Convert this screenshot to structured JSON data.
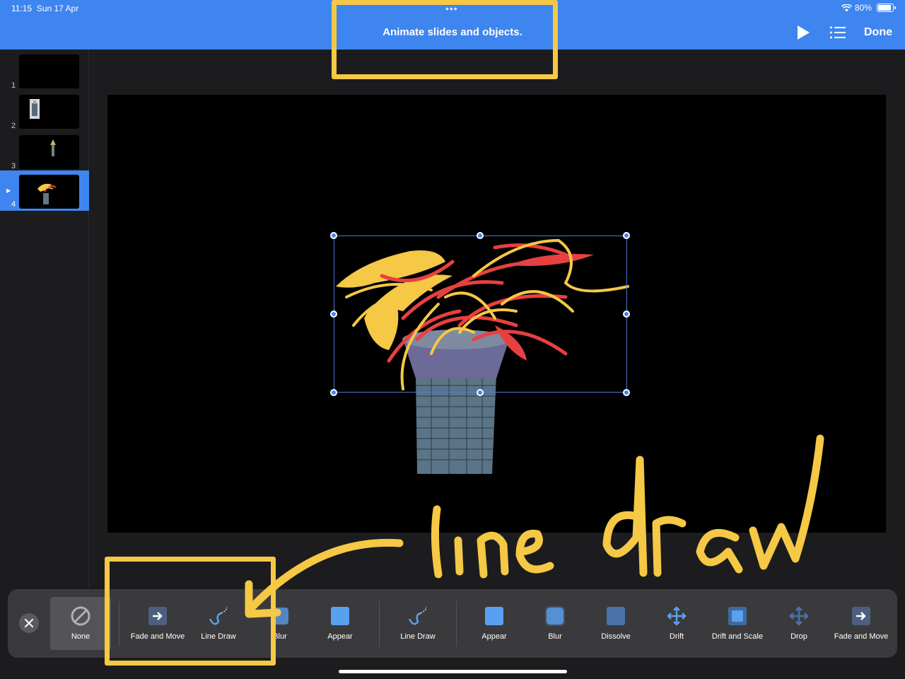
{
  "status": {
    "time": "11:15",
    "date": "Sun 17 Apr",
    "battery": "80%"
  },
  "nav": {
    "title": "Animate slides and objects.",
    "done_label": "Done",
    "grabber": "•••"
  },
  "slides": [
    {
      "number": "1"
    },
    {
      "number": "2"
    },
    {
      "number": "3"
    },
    {
      "number": "4",
      "selected": true
    }
  ],
  "animations": [
    {
      "label": "None",
      "icon": "none-icon",
      "selected": true
    },
    {
      "label": "Fade and Move",
      "icon": "fade-move-icon"
    },
    {
      "label": "Line Draw",
      "icon": "line-draw-icon"
    },
    {
      "label": "Blur",
      "icon": "blur-icon"
    },
    {
      "label": "Appear",
      "icon": "appear-icon"
    },
    {
      "label": "Line Draw",
      "icon": "line-draw-icon"
    },
    {
      "label": "Appear",
      "icon": "appear-icon"
    },
    {
      "label": "Blur",
      "icon": "blur-icon"
    },
    {
      "label": "Dissolve",
      "icon": "dissolve-icon"
    },
    {
      "label": "Drift",
      "icon": "drift-icon"
    },
    {
      "label": "Drift and Scale",
      "icon": "drift-scale-icon"
    },
    {
      "label": "Drop",
      "icon": "drop-icon"
    },
    {
      "label": "Fade and Move",
      "icon": "fade-move-icon"
    }
  ],
  "annotation": {
    "handwriting": "line draw"
  },
  "colors": {
    "accent": "#3e85f0",
    "annotation": "#f5c845",
    "bar": "#3a3a3c",
    "background": "#1c1c1e"
  }
}
